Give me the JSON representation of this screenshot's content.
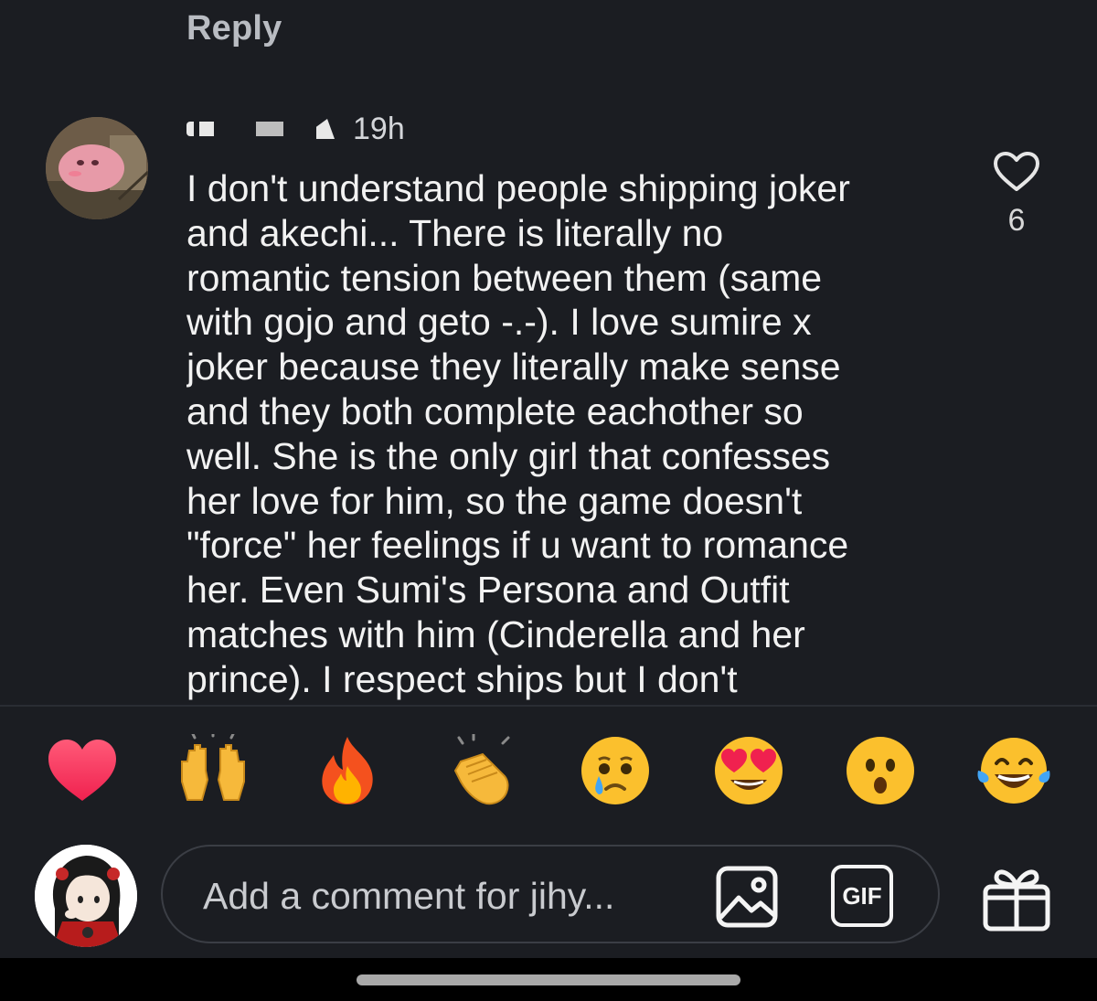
{
  "reply_label": "Reply",
  "comment": {
    "timestamp": "19h",
    "text": "I don't understand people shipping joker\nand akechi... There is literally no\nromantic tension between them (same\nwith gojo and geto -.-). I love sumire x\njoker because they literally make sense\nand they both complete eachother so\nwell. She is the only girl that confesses\nher love for him, so the game doesn't\n\"force\" her feelings if u want to romance\nher. Even Sumi's Persona and Outfit\nmatches with him (Cinderella and her\nprince). I respect ships but I don't",
    "like_count": "6",
    "like_icon": "heart-outline-icon"
  },
  "reactions": [
    {
      "name": "red-heart",
      "emoji": "❤️"
    },
    {
      "name": "raising-hands",
      "emoji": "🙌"
    },
    {
      "name": "fire",
      "emoji": "🔥"
    },
    {
      "name": "clapping-hands",
      "emoji": "👏"
    },
    {
      "name": "crying-face",
      "emoji": "😢"
    },
    {
      "name": "heart-eyes",
      "emoji": "😍"
    },
    {
      "name": "surprised-face",
      "emoji": "😮"
    },
    {
      "name": "tears-of-joy",
      "emoji": "😂"
    }
  ],
  "composer": {
    "placeholder": "Add a comment for jihy...",
    "gif_label": "GIF",
    "image_icon": "image-icon",
    "gift_icon": "gift-icon"
  },
  "colors": {
    "background": "#1b1d22",
    "text": "#f2f2f2",
    "muted": "#b9bcc2",
    "divider": "#2a2d33"
  }
}
